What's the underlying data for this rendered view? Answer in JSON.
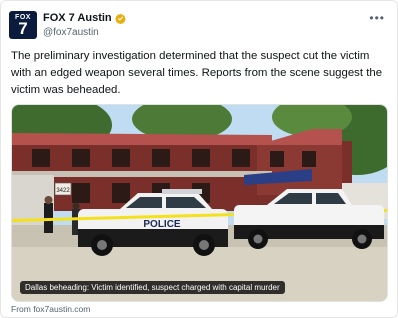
{
  "account": {
    "name": "FOX 7 Austin",
    "handle": "@fox7austin",
    "avatar_text_top": "FOX",
    "avatar_text_main": "7",
    "verified_color": "#e8b00f"
  },
  "menu_icon": "more-dots-icon",
  "tweet": {
    "text": "The preliminary investigation determined that the suspect cut the victim with an edged weapon several times. Reports from the scene suggest the victim was beheaded."
  },
  "media": {
    "caption": "Dallas beheading: Victim identified, suspect charged with capital murder",
    "address_sign": "3422",
    "vehicle_text": "POLICE",
    "source": "From fox7austin.com"
  },
  "colors": {
    "text_primary": "#0f1419",
    "text_secondary": "#536471",
    "sky": "#bfdcf2",
    "roof": "#b5524e",
    "police_tape": "#f4e01b"
  }
}
